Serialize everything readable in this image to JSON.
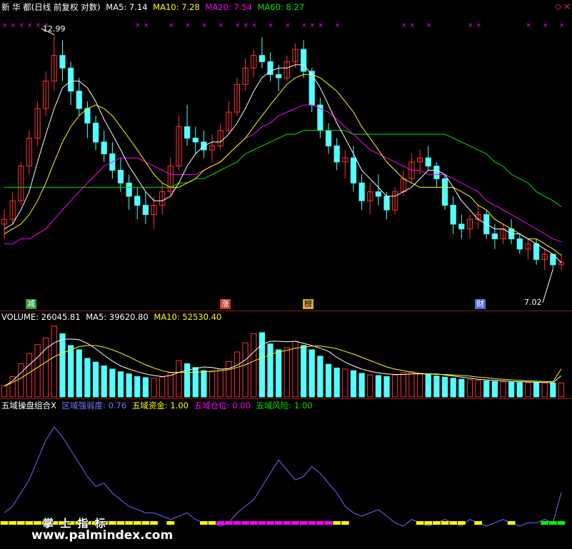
{
  "main_header": {
    "name": "新 华 都(日线 前复权 对数)",
    "ma5": "MA5: 7.14",
    "ma10": "MA10: 7.28",
    "ma20": "MA20: 7.54",
    "ma60": "MA60: 8.27"
  },
  "volume_header": {
    "title": "VOLUME: 26045.81",
    "ma5": "MA5: 39620.80",
    "ma10": "MA10: 52530.40"
  },
  "indicator_header": {
    "name": "五域操盘组合X",
    "qy": "区域强弱度: 0.76",
    "zj": "五域资金: 1.00",
    "cw": "五域仓位: 0.00",
    "fx": "五域风险: 1.00"
  },
  "markers": {
    "high": "12.99",
    "low": "7.02",
    "tags": [
      "减",
      "涨",
      "榜",
      "财"
    ]
  },
  "watermark": {
    "cn": "掌 上 指 标",
    "url": "www.palmindex.com"
  },
  "colors": {
    "up": "#ff3232",
    "down": "#54ffff",
    "ma5": "#ffffff",
    "ma10": "#ffff00",
    "ma20": "#ff00ff",
    "ma60": "#00e600",
    "qy_line": "#6c6cff",
    "signal_yellow": "#ffff00",
    "signal_magenta": "#ff00ff",
    "signal_green": "#00ff00",
    "border": "#8a1a1a"
  },
  "chart_data": {
    "type": "candlestick",
    "ohlc": [
      [
        7.9,
        8.2,
        7.6,
        8.0
      ],
      [
        8.0,
        8.6,
        7.9,
        8.4
      ],
      [
        8.4,
        9.3,
        8.3,
        9.2
      ],
      [
        9.2,
        10.1,
        9.0,
        9.9
      ],
      [
        9.9,
        10.9,
        9.7,
        10.7
      ],
      [
        10.7,
        11.8,
        10.5,
        11.5
      ],
      [
        11.5,
        12.99,
        11.2,
        12.3
      ],
      [
        12.3,
        12.8,
        11.5,
        11.9
      ],
      [
        11.9,
        12.1,
        10.8,
        11.2
      ],
      [
        11.2,
        11.6,
        10.5,
        10.7
      ],
      [
        10.7,
        10.9,
        9.9,
        10.3
      ],
      [
        10.3,
        10.5,
        9.6,
        9.8
      ],
      [
        9.8,
        10.1,
        9.3,
        9.5
      ],
      [
        9.5,
        9.8,
        8.9,
        9.1
      ],
      [
        9.1,
        9.4,
        8.6,
        8.8
      ],
      [
        8.8,
        9.0,
        8.2,
        8.5
      ],
      [
        8.5,
        8.7,
        8.0,
        8.3
      ],
      [
        8.3,
        8.6,
        7.9,
        8.1
      ],
      [
        8.1,
        8.5,
        7.8,
        8.3
      ],
      [
        8.3,
        8.8,
        8.1,
        8.6
      ],
      [
        8.6,
        9.4,
        8.5,
        9.2
      ],
      [
        9.2,
        10.5,
        9.1,
        10.2
      ],
      [
        10.2,
        10.8,
        9.7,
        9.9
      ],
      [
        9.9,
        10.2,
        9.5,
        9.8
      ],
      [
        9.8,
        10.1,
        9.4,
        9.6
      ],
      [
        9.6,
        10.0,
        9.3,
        9.7
      ],
      [
        9.7,
        10.3,
        9.6,
        10.1
      ],
      [
        10.1,
        10.9,
        10.0,
        10.6
      ],
      [
        10.6,
        11.6,
        10.5,
        11.4
      ],
      [
        11.4,
        12.2,
        11.2,
        11.9
      ],
      [
        11.9,
        12.5,
        11.6,
        12.3
      ],
      [
        12.3,
        12.9,
        11.9,
        12.1
      ],
      [
        12.1,
        12.4,
        11.5,
        11.7
      ],
      [
        11.7,
        12.0,
        11.2,
        11.6
      ],
      [
        11.6,
        12.3,
        11.5,
        12.1
      ],
      [
        12.1,
        12.7,
        11.9,
        12.5
      ],
      [
        12.5,
        12.8,
        11.6,
        11.8
      ],
      [
        11.8,
        11.9,
        10.6,
        10.8
      ],
      [
        10.8,
        11.0,
        9.9,
        10.1
      ],
      [
        10.1,
        10.3,
        9.5,
        9.7
      ],
      [
        9.7,
        9.9,
        9.1,
        9.3
      ],
      [
        9.3,
        9.6,
        8.9,
        9.4
      ],
      [
        9.4,
        9.7,
        8.6,
        8.8
      ],
      [
        8.8,
        9.0,
        8.2,
        8.4
      ],
      [
        8.4,
        8.8,
        8.1,
        8.6
      ],
      [
        8.6,
        9.0,
        8.3,
        8.5
      ],
      [
        8.5,
        8.6,
        8.0,
        8.2
      ],
      [
        8.2,
        8.7,
        8.1,
        8.6
      ],
      [
        8.6,
        9.1,
        8.5,
        8.9
      ],
      [
        8.9,
        9.5,
        8.8,
        9.3
      ],
      [
        9.3,
        9.6,
        9.0,
        9.4
      ],
      [
        9.4,
        9.7,
        9.1,
        9.2
      ],
      [
        9.2,
        9.3,
        8.7,
        8.9
      ],
      [
        8.9,
        9.0,
        8.2,
        8.3
      ],
      [
        8.3,
        8.5,
        7.7,
        7.9
      ],
      [
        7.9,
        8.1,
        7.6,
        7.8
      ],
      [
        7.8,
        8.1,
        7.6,
        8.0
      ],
      [
        8.0,
        8.3,
        7.8,
        8.1
      ],
      [
        8.1,
        8.2,
        7.6,
        7.7
      ],
      [
        7.7,
        7.9,
        7.4,
        7.6
      ],
      [
        7.6,
        7.9,
        7.5,
        7.8
      ],
      [
        7.8,
        8.0,
        7.5,
        7.6
      ],
      [
        7.6,
        7.7,
        7.3,
        7.4
      ],
      [
        7.4,
        7.6,
        7.2,
        7.5
      ],
      [
        7.5,
        7.6,
        7.1,
        7.2
      ],
      [
        7.2,
        7.4,
        7.0,
        7.3
      ],
      [
        7.3,
        7.3,
        7.02,
        7.1
      ],
      [
        7.1,
        7.3,
        7.0,
        7.14
      ]
    ],
    "ma5": [
      7.8,
      7.9,
      8.2,
      8.6,
      9.3,
      10.0,
      10.7,
      11.3,
      11.5,
      11.5,
      11.3,
      10.9,
      10.4,
      10.0,
      9.6,
      9.2,
      8.9,
      8.6,
      8.4,
      8.4,
      8.5,
      8.8,
      9.2,
      9.5,
      9.7,
      9.8,
      9.8,
      10.0,
      10.3,
      10.7,
      11.2,
      11.6,
      11.8,
      11.9,
      11.9,
      12.0,
      12.0,
      11.7,
      11.3,
      10.8,
      10.3,
      9.9,
      9.5,
      9.1,
      8.9,
      8.7,
      8.5,
      8.5,
      8.6,
      8.7,
      8.9,
      9.1,
      9.1,
      9.0,
      8.7,
      8.4,
      8.2,
      8.0,
      7.9,
      7.8,
      7.8,
      7.7,
      7.7,
      7.6,
      7.5,
      7.4,
      7.3,
      7.14
    ],
    "ma10": [
      7.7,
      7.8,
      7.9,
      8.1,
      8.4,
      8.8,
      9.3,
      9.8,
      10.2,
      10.5,
      10.7,
      10.8,
      10.7,
      10.5,
      10.2,
      9.9,
      9.6,
      9.3,
      9.0,
      8.8,
      8.7,
      8.7,
      8.8,
      8.9,
      9.1,
      9.2,
      9.3,
      9.5,
      9.7,
      9.9,
      10.2,
      10.5,
      10.8,
      11.1,
      11.4,
      11.6,
      11.7,
      11.7,
      11.6,
      11.4,
      11.2,
      10.9,
      10.6,
      10.2,
      9.9,
      9.6,
      9.3,
      9.1,
      8.9,
      8.8,
      8.7,
      8.7,
      8.7,
      8.7,
      8.7,
      8.6,
      8.5,
      8.3,
      8.2,
      8.0,
      7.9,
      7.8,
      7.7,
      7.6,
      7.6,
      7.5,
      7.4,
      7.28
    ],
    "ma20": [
      7.5,
      7.5,
      7.6,
      7.6,
      7.7,
      7.8,
      8.0,
      8.2,
      8.4,
      8.6,
      8.8,
      9.0,
      9.2,
      9.3,
      9.4,
      9.4,
      9.4,
      9.3,
      9.2,
      9.1,
      9.0,
      9.0,
      9.0,
      9.0,
      9.1,
      9.2,
      9.3,
      9.5,
      9.7,
      9.9,
      10.0,
      10.2,
      10.3,
      10.5,
      10.6,
      10.7,
      10.8,
      10.8,
      10.7,
      10.6,
      10.4,
      10.2,
      10.0,
      9.8,
      9.6,
      9.5,
      9.4,
      9.3,
      9.2,
      9.1,
      9.1,
      9.0,
      9.0,
      9.0,
      8.9,
      8.8,
      8.7,
      8.6,
      8.4,
      8.3,
      8.2,
      8.1,
      8.0,
      7.9,
      7.8,
      7.7,
      7.6,
      7.54
    ],
    "ma60": [
      8.7,
      8.7,
      8.7,
      8.7,
      8.7,
      8.7,
      8.7,
      8.7,
      8.7,
      8.7,
      8.7,
      8.7,
      8.7,
      8.7,
      8.7,
      8.7,
      8.7,
      8.7,
      8.7,
      8.7,
      8.7,
      8.8,
      8.8,
      8.9,
      8.9,
      9.0,
      9.1,
      9.2,
      9.3,
      9.5,
      9.6,
      9.7,
      9.8,
      9.9,
      10.0,
      10.0,
      10.1,
      10.1,
      10.1,
      10.1,
      10.1,
      10.1,
      10.0,
      10.0,
      10.0,
      10.0,
      10.0,
      10.0,
      10.0,
      10.0,
      10.0,
      10.0,
      10.0,
      10.0,
      9.9,
      9.8,
      9.7,
      9.6,
      9.5,
      9.3,
      9.2,
      9.0,
      8.9,
      8.8,
      8.6,
      8.5,
      8.4,
      8.27
    ],
    "volume": [
      21000,
      38000,
      62000,
      81000,
      98000,
      110000,
      132000,
      118000,
      96000,
      88000,
      72000,
      65000,
      58000,
      52000,
      47000,
      43000,
      38000,
      36000,
      35000,
      37000,
      45000,
      68000,
      62000,
      55000,
      49000,
      47000,
      52000,
      66000,
      84000,
      101000,
      118000,
      120000,
      99000,
      88000,
      92000,
      104000,
      96000,
      88000,
      76000,
      61000,
      54000,
      52000,
      49000,
      44000,
      41000,
      40000,
      38000,
      41000,
      45000,
      47000,
      44000,
      42000,
      39000,
      37000,
      35000,
      33000,
      32000,
      31000,
      30000,
      29000,
      28000,
      27500,
      27000,
      26800,
      26500,
      26300,
      26100,
      26045.81
    ],
    "vol_ma5": [
      20000,
      30000,
      45000,
      60000,
      74000,
      90000,
      101000,
      108000,
      108000,
      107000,
      100000,
      90000,
      78000,
      67000,
      58000,
      52000,
      47000,
      43000,
      40000,
      38000,
      40000,
      46000,
      50000,
      53000,
      56000,
      55000,
      52000,
      53000,
      59000,
      69000,
      84000,
      98000,
      104000,
      104000,
      103000,
      104000,
      100000,
      96000,
      91000,
      85000,
      74000,
      65000,
      58000,
      52000,
      48000,
      45000,
      43000,
      42000,
      42000,
      43000,
      43000,
      43000,
      43000,
      41000,
      39000,
      37000,
      35000,
      33000,
      32000,
      31000,
      30000,
      29000,
      28500,
      28000,
      27500,
      27000,
      26700,
      39620.8
    ],
    "vol_ma10": [
      20000,
      27000,
      35000,
      45000,
      55000,
      65000,
      75000,
      82000,
      88000,
      94000,
      96000,
      96000,
      93000,
      88000,
      82000,
      75000,
      67000,
      60000,
      54000,
      49000,
      46000,
      46000,
      46000,
      46000,
      47000,
      48000,
      49000,
      51000,
      55000,
      60000,
      67000,
      73000,
      79000,
      84000,
      87000,
      91000,
      93000,
      95000,
      95000,
      93000,
      90000,
      85000,
      80000,
      74000,
      68000,
      62000,
      56000,
      52000,
      49000,
      46000,
      44000,
      43000,
      42000,
      42000,
      41000,
      40000,
      39000,
      37000,
      36000,
      34000,
      33000,
      32000,
      31000,
      30000,
      29500,
      29000,
      28500,
      52530.4
    ],
    "qy": [
      0.45,
      0.55,
      0.75,
      0.95,
      1.25,
      1.55,
      1.75,
      1.6,
      1.4,
      1.2,
      1.0,
      0.85,
      0.9,
      0.75,
      0.65,
      0.55,
      0.5,
      0.45,
      0.45,
      0.4,
      0.35,
      0.4,
      0.45,
      0.35,
      0.3,
      0.3,
      0.25,
      0.3,
      0.45,
      0.55,
      0.65,
      0.85,
      1.05,
      1.25,
      1.1,
      0.95,
      1.0,
      1.15,
      1.05,
      0.9,
      0.75,
      0.55,
      0.45,
      0.4,
      0.45,
      0.5,
      0.4,
      0.3,
      0.25,
      0.35,
      0.3,
      0.25,
      0.3,
      0.35,
      0.3,
      0.25,
      0.35,
      0.3,
      0.25,
      0.3,
      0.35,
      0.3,
      0.25,
      0.3,
      0.3,
      0.35,
      0.3,
      0.76
    ],
    "signal": [
      "y",
      "y",
      "y",
      "y",
      "y",
      "y",
      "y",
      "y",
      "y",
      "y",
      "y",
      "y",
      "y",
      "y",
      "y",
      "y",
      "y",
      "y",
      "y",
      "n",
      "y",
      "n",
      "n",
      "n",
      "y",
      "y",
      "m",
      "m",
      "m",
      "m",
      "m",
      "m",
      "m",
      "m",
      "m",
      "m",
      "m",
      "m",
      "m",
      "m",
      "y",
      "y",
      "n",
      "n",
      "n",
      "n",
      "n",
      "n",
      "n",
      "n",
      "y",
      "y",
      "y",
      "y",
      "y",
      "y",
      "n",
      "y",
      "n",
      "n",
      "n",
      "y",
      "n",
      "n",
      "n",
      "g",
      "g",
      "g"
    ],
    "xlim": [
      0,
      67
    ],
    "ylim_price": [
      6.5,
      13.5
    ],
    "ylim_qy": [
      0,
      2.0
    ]
  }
}
